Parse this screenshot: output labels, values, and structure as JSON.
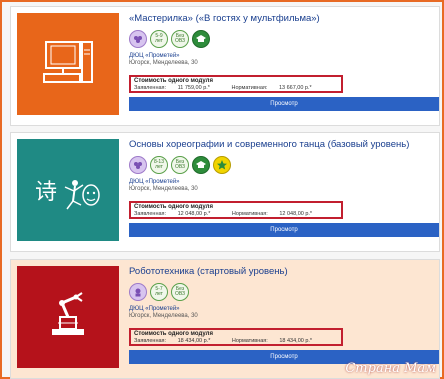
{
  "cards": [
    {
      "title": "«Мастерилка» («В гостях у мультфильма»)",
      "badges": [
        "",
        "5-9 лет",
        "Без ОВЗ",
        ""
      ],
      "org": "ДЮЦ «Прометей»",
      "address": "Югорск, Менделеева, 30",
      "price_label": "Стоимость одного модуля",
      "declared_label": "Заявленная:",
      "declared_value": "11 759,00 р.*",
      "normative_label": "Нормативная:",
      "normative_value": "13 667,00 р.*",
      "view_label": "Просмотр",
      "accent": "#e8661a"
    },
    {
      "title": "Основы хореографии и современного танца (базовый уровень)",
      "badges": [
        "",
        "8-13 лет",
        "Без ОВЗ",
        "",
        ""
      ],
      "org": "ДЮЦ «Прометей»",
      "address": "Югорск, Менделеева, 30",
      "price_label": "Стоимость одного модуля",
      "declared_label": "Заявленная:",
      "declared_value": "12 048,00 р.*",
      "normative_label": "Нормативная:",
      "normative_value": "12 048,00 р.*",
      "view_label": "Просмотр",
      "accent": "#1f8a84"
    },
    {
      "title": "Робототехника (стартовый уровень)",
      "badges": [
        "",
        "5-7 лет",
        "Без ОВЗ"
      ],
      "org": "ДЮЦ «Прометей»",
      "address": "Югорск, Менделеева, 30",
      "price_label": "Стоимость одного модуля",
      "declared_label": "Заявленная:",
      "declared_value": "18 434,00 р.*",
      "normative_label": "Нормативная:",
      "normative_value": "18 434,00 р.*",
      "view_label": "Просмотр",
      "accent": "#b5121b"
    }
  ],
  "watermark": "Страна Мам"
}
